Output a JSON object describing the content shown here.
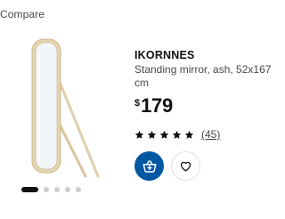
{
  "compare": {
    "label": "Compare"
  },
  "product": {
    "name": "IKORNNES",
    "description": "Standing mirror, ash, 52x167 cm",
    "price": {
      "currency": "$",
      "amount": "179"
    },
    "rating": {
      "stars": 5,
      "max_stars": 5,
      "review_count": "(45)"
    }
  },
  "carousel": {
    "total": 5,
    "active_index": 0
  },
  "actions": {
    "add_to_cart_icon": "add-to-cart-icon",
    "favorite_icon": "heart-icon"
  },
  "colors": {
    "accent_blue": "#0058a3",
    "text_primary": "#111111",
    "text_secondary": "#484848",
    "dot_inactive": "#cfcfcf"
  }
}
